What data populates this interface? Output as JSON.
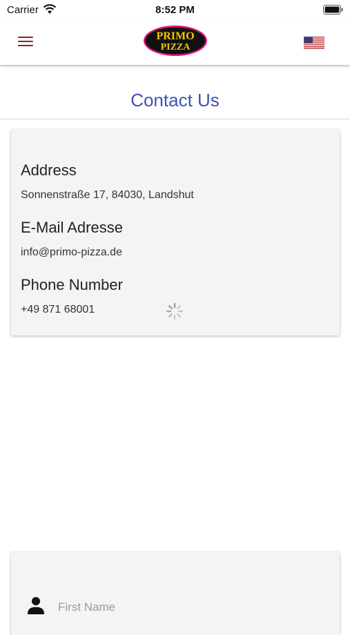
{
  "status_bar": {
    "carrier": "Carrier",
    "time": "8:52 PM"
  },
  "header": {
    "logo_text_line1": "PRIMO",
    "logo_text_line2": "PIZZA",
    "icons": [
      "menu-icon",
      "us-flag-icon"
    ]
  },
  "page": {
    "title": "Contact Us"
  },
  "contact": {
    "address_label": "Address",
    "address_value": "Sonnenstraße 17, 84030, Landshut",
    "email_label": "E-Mail Adresse",
    "email_value": "info@primo-pizza.de",
    "phone_label": "Phone Number",
    "phone_value": "+49 871 68001"
  },
  "form": {
    "first_name_placeholder": "First Name",
    "first_name_value": ""
  },
  "colors": {
    "accent": "#3f51b5",
    "brand_red": "#9b1b20",
    "logo_yellow": "#f5c400",
    "logo_pink": "#e0147a"
  }
}
